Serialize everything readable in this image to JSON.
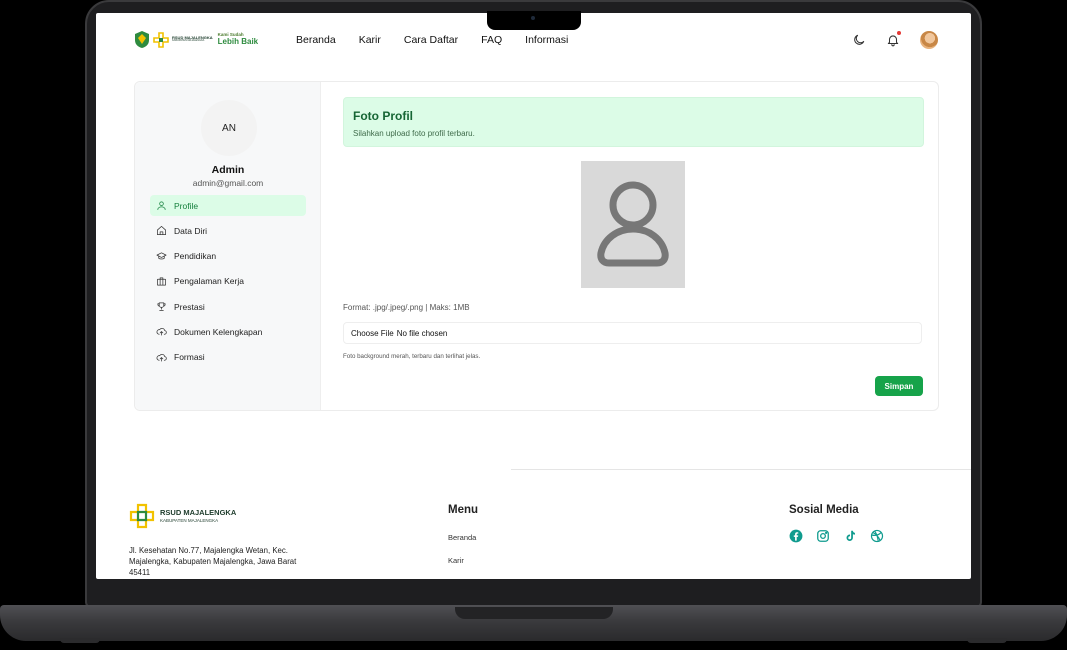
{
  "navbar": {
    "logo_title": "RSUD MAJALENGKA",
    "logo_subtitle": "KABUPATEN MAJALENGKA",
    "motto_line1": "Kami Sudah",
    "motto_line2": "Lebih Baik",
    "links": [
      "Beranda",
      "Karir",
      "Cara Daftar",
      "FAQ",
      "Informasi"
    ],
    "icons": [
      "moon-icon",
      "bell-icon",
      "avatar"
    ]
  },
  "sidebar": {
    "avatar_initials": "AN",
    "name": "Admin",
    "email": "admin@gmail.com",
    "items": [
      {
        "label": "Profile",
        "icon": "user-icon",
        "active": true
      },
      {
        "label": "Data Diri",
        "icon": "home-icon",
        "active": false
      },
      {
        "label": "Pendidikan",
        "icon": "graduation-cap-icon",
        "active": false
      },
      {
        "label": "Pengalaman Kerja",
        "icon": "briefcase-icon",
        "active": false
      },
      {
        "label": "Prestasi",
        "icon": "trophy-icon",
        "active": false
      },
      {
        "label": "Dokumen Kelengkapan",
        "icon": "cloud-upload-icon",
        "active": false
      },
      {
        "label": "Formasi",
        "icon": "cloud-upload-icon",
        "active": false
      }
    ]
  },
  "content": {
    "alert_title": "Foto Profil",
    "alert_text": "Silahkan upload foto profil terbaru.",
    "format_text": "Format: .jpg/.jpeg/.png | Maks: 1MB",
    "file_button": "Choose File",
    "file_status": "No file chosen",
    "hint_text": "Foto background merah, terbaru dan terlihat jelas.",
    "save_label": "Simpan"
  },
  "footer": {
    "logo_title": "RSUD MAJALENGKA",
    "logo_subtitle": "KABUPATEN MAJALENGKA",
    "address": "Jl. Kesehatan No.77, Majalengka Wetan, Kec. Majalengka, Kabupaten Majalengka, Jawa Barat 45411",
    "menu_title": "Menu",
    "menu_links": [
      "Beranda",
      "Karir"
    ],
    "social_title": "Sosial Media",
    "social_icons": [
      "facebook-icon",
      "instagram-icon",
      "tiktok-icon",
      "dribbble-icon"
    ],
    "accent_color": "#0f9b8e"
  },
  "colors": {
    "primary": "#16a34a",
    "alert_bg": "#dcfce7",
    "alert_title": "#166534"
  }
}
